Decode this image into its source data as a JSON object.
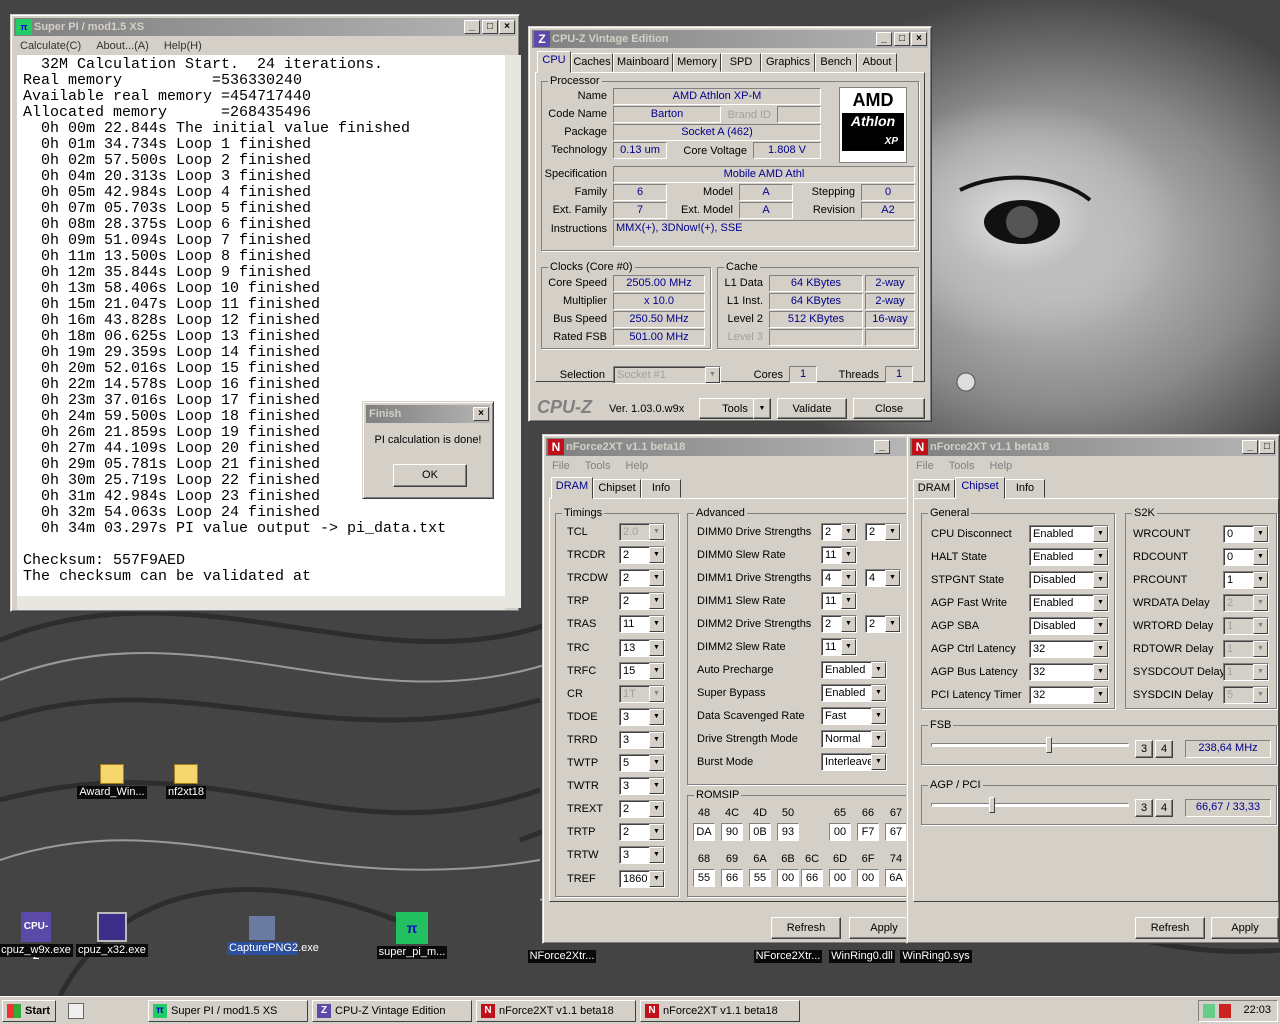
{
  "superpi": {
    "title": "Super PI / mod1.5 XS",
    "menu": [
      "Calculate(C)",
      "About...(A)",
      "Help(H)"
    ],
    "lines": [
      "  32M Calculation Start.  24 iterations.",
      "Real memory          =536330240",
      "Available real memory =454717440",
      "Allocated memory      =268435496",
      "  0h 00m 22.844s The initial value finished",
      "  0h 01m 34.734s Loop 1 finished",
      "  0h 02m 57.500s Loop 2 finished",
      "  0h 04m 20.313s Loop 3 finished",
      "  0h 05m 42.984s Loop 4 finished",
      "  0h 07m 05.703s Loop 5 finished",
      "  0h 08m 28.375s Loop 6 finished",
      "  0h 09m 51.094s Loop 7 finished",
      "  0h 11m 13.500s Loop 8 finished",
      "  0h 12m 35.844s Loop 9 finished",
      "  0h 13m 58.406s Loop 10 finished",
      "  0h 15m 21.047s Loop 11 finished",
      "  0h 16m 43.828s Loop 12 finished",
      "  0h 18m 06.625s Loop 13 finished",
      "  0h 19m 29.359s Loop 14 finished",
      "  0h 20m 52.016s Loop 15 finished",
      "  0h 22m 14.578s Loop 16 finished",
      "  0h 23m 37.016s Loop 17 finished",
      "  0h 24m 59.500s Loop 18 finished",
      "  0h 26m 21.859s Loop 19 finished",
      "  0h 27m 44.109s Loop 20 finished",
      "  0h 29m 05.781s Loop 21 finished",
      "  0h 30m 25.719s Loop 22 finished",
      "  0h 31m 42.984s Loop 23 finished",
      "  0h 32m 54.063s Loop 24 finished",
      "  0h 34m 03.297s PI value output -> pi_data.txt",
      "",
      "Checksum: 557F9AED",
      "The checksum can be validated at"
    ]
  },
  "finish": {
    "title": "Finish",
    "message": "PI calculation is done!",
    "ok": "OK"
  },
  "cpuz": {
    "title": "CPU-Z Vintage Edition",
    "tabs": [
      "CPU",
      "Caches",
      "Mainboard",
      "Memory",
      "SPD",
      "Graphics",
      "Bench",
      "About"
    ],
    "processor": {
      "group": "Processor",
      "name_l": "Name",
      "name": "AMD Athlon XP-M",
      "code_l": "Code Name",
      "code": "Barton",
      "brand_l": "Brand ID",
      "pkg_l": "Package",
      "pkg": "Socket A (462)",
      "tech_l": "Technology",
      "tech": "0.13 um",
      "volt_l": "Core Voltage",
      "volt": "1.808 V",
      "spec_l": "Specification",
      "spec": "Mobile AMD Athl",
      "fam_l": "Family",
      "fam": "6",
      "model_l": "Model",
      "model": "A",
      "step_l": "Stepping",
      "step": "0",
      "efam_l": "Ext. Family",
      "efam": "7",
      "emodel_l": "Ext. Model",
      "emodel": "A",
      "rev_l": "Revision",
      "rev": "A2",
      "instr_l": "Instructions",
      "instr": "MMX(+), 3DNow!(+), SSE",
      "logo1": "AMD",
      "logo2": "Athlon",
      "logo3": "XP"
    },
    "clocks": {
      "group": "Clocks (Core #0)",
      "speed_l": "Core Speed",
      "speed": "2505.00 MHz",
      "mult_l": "Multiplier",
      "mult": "x 10.0",
      "bus_l": "Bus Speed",
      "bus": "250.50 MHz",
      "fsb_l": "Rated FSB",
      "fsb": "501.00 MHz"
    },
    "cache": {
      "group": "Cache",
      "l1d_l": "L1 Data",
      "l1d": "64 KBytes",
      "l1d_w": "2-way",
      "l1i_l": "L1 Inst.",
      "l1i": "64 KBytes",
      "l1i_w": "2-way",
      "l2_l": "Level 2",
      "l2": "512 KBytes",
      "l2_w": "16-way",
      "l3_l": "Level 3"
    },
    "selection_l": "Selection",
    "selection": "Socket #1",
    "cores_l": "Cores",
    "cores": "1",
    "threads_l": "Threads",
    "threads": "1",
    "brand": "CPU-Z",
    "version": "Ver. 1.03.0.w9x",
    "tools": "Tools",
    "validate": "Validate",
    "close": "Close"
  },
  "nf1": {
    "title": "nForce2XT v1.1 beta18",
    "menu": [
      "File",
      "Tools",
      "Help"
    ],
    "tabs": [
      "DRAM",
      "Chipset",
      "Info"
    ],
    "timings_group": "Timings",
    "timings": [
      {
        "l": "TCL",
        "v": "2.0",
        "d": true
      },
      {
        "l": "TRCDR",
        "v": "2"
      },
      {
        "l": "TRCDW",
        "v": "2"
      },
      {
        "l": "TRP",
        "v": "2"
      },
      {
        "l": "TRAS",
        "v": "11"
      },
      {
        "l": "TRC",
        "v": "13"
      },
      {
        "l": "TRFC",
        "v": "15"
      },
      {
        "l": "CR",
        "v": "1T",
        "d": true
      },
      {
        "l": "TDOE",
        "v": "3"
      },
      {
        "l": "TRRD",
        "v": "3"
      },
      {
        "l": "TWTP",
        "v": "5"
      },
      {
        "l": "TWTR",
        "v": "3"
      },
      {
        "l": "TREXT",
        "v": "2"
      },
      {
        "l": "TRTP",
        "v": "2"
      },
      {
        "l": "TRTW",
        "v": "3"
      },
      {
        "l": "TREF",
        "v": "1860"
      }
    ],
    "adv_group": "Advanced",
    "adv": [
      {
        "l": "DIMM0 Drive Strengths",
        "a": "2",
        "b": "2"
      },
      {
        "l": "DIMM0 Slew Rate",
        "a": "11"
      },
      {
        "l": "DIMM1 Drive Strengths",
        "a": "4",
        "b": "4"
      },
      {
        "l": "DIMM1 Slew Rate",
        "a": "11"
      },
      {
        "l": "DIMM2 Drive Strengths",
        "a": "2",
        "b": "2"
      },
      {
        "l": "DIMM2 Slew Rate",
        "a": "11"
      },
      {
        "l": "Auto Precharge",
        "w": "Enabled"
      },
      {
        "l": "Super Bypass",
        "w": "Enabled"
      },
      {
        "l": "Data Scavenged Rate",
        "w": "Fast"
      },
      {
        "l": "Drive Strength Mode",
        "w": "Normal"
      },
      {
        "l": "Burst Mode",
        "w": "Interleave"
      }
    ],
    "romsip_group": "ROMSIP",
    "romsip1": [
      {
        "h": "48",
        "v": "DA"
      },
      {
        "h": "4C",
        "v": "90"
      },
      {
        "h": "4D",
        "v": "0B"
      },
      {
        "h": "50",
        "v": "93"
      },
      {
        "h": "65",
        "v": "00"
      },
      {
        "h": "66",
        "v": "F7"
      },
      {
        "h": "67",
        "v": "67"
      }
    ],
    "romsip2": [
      {
        "h": "68",
        "v": "55"
      },
      {
        "h": "69",
        "v": "66"
      },
      {
        "h": "6A",
        "v": "55"
      },
      {
        "h": "6B",
        "v": "00"
      },
      {
        "h": "6C",
        "v": "66"
      },
      {
        "h": "6D",
        "v": "00"
      },
      {
        "h": "6F",
        "v": "00"
      },
      {
        "h": "74",
        "v": "6A"
      }
    ],
    "refresh": "Refresh",
    "apply": "Apply"
  },
  "nf2": {
    "title": "nForce2XT v1.1 beta18",
    "menu": [
      "File",
      "Tools",
      "Help"
    ],
    "tabs": [
      "DRAM",
      "Chipset",
      "Info"
    ],
    "gen_group": "General",
    "gen": [
      {
        "l": "CPU Disconnect",
        "v": "Enabled"
      },
      {
        "l": "HALT State",
        "v": "Enabled"
      },
      {
        "l": "STPGNT State",
        "v": "Disabled"
      },
      {
        "l": "AGP Fast Write",
        "v": "Enabled"
      },
      {
        "l": "AGP SBA",
        "v": "Disabled"
      },
      {
        "l": "AGP Ctrl Latency",
        "v": "32"
      },
      {
        "l": "AGP Bus Latency",
        "v": "32"
      },
      {
        "l": "PCI Latency Timer",
        "v": "32"
      }
    ],
    "s2k_group": "S2K",
    "s2k": [
      {
        "l": "WRCOUNT",
        "v": "0"
      },
      {
        "l": "RDCOUNT",
        "v": "0"
      },
      {
        "l": "PRCOUNT",
        "v": "1"
      },
      {
        "l": "WRDATA Delay",
        "v": "2",
        "d": true
      },
      {
        "l": "WRTORD Delay",
        "v": "1",
        "d": true
      },
      {
        "l": "RDTOWR Delay",
        "v": "1",
        "d": true
      },
      {
        "l": "SYSDCOUT Delay",
        "v": "1",
        "d": true
      },
      {
        "l": "SYSDCIN Delay",
        "v": "5",
        "d": true
      }
    ],
    "fsb_group": "FSB",
    "fsb_b1": "3",
    "fsb_b2": "4",
    "fsb_val": "238,64 MHz",
    "fsb_level": 0.6,
    "agp_group": "AGP / PCI",
    "agp_b1": "3",
    "agp_b2": "4",
    "agp_val": "66,67 / 33,33",
    "agp_level": 0.3,
    "refresh": "Refresh",
    "apply": "Apply"
  },
  "desktop": {
    "icons": [
      "Award_Win...",
      "nf2xt18",
      "cpuz_w9x.exe",
      "cpuz_x32.exe",
      "CapturePNG2.exe",
      "super_pi_m...",
      "NForce2Xtr...",
      "NForce2Xtr...",
      "WinRing0.dll",
      "WinRing0.sys"
    ]
  },
  "taskbar": {
    "start": "Start",
    "items": [
      "Super PI / mod1.5 XS",
      "CPU-Z Vintage Edition",
      "nForce2XT v1.1 beta18",
      "nForce2XT v1.1 beta18"
    ],
    "clock": "22:03"
  }
}
